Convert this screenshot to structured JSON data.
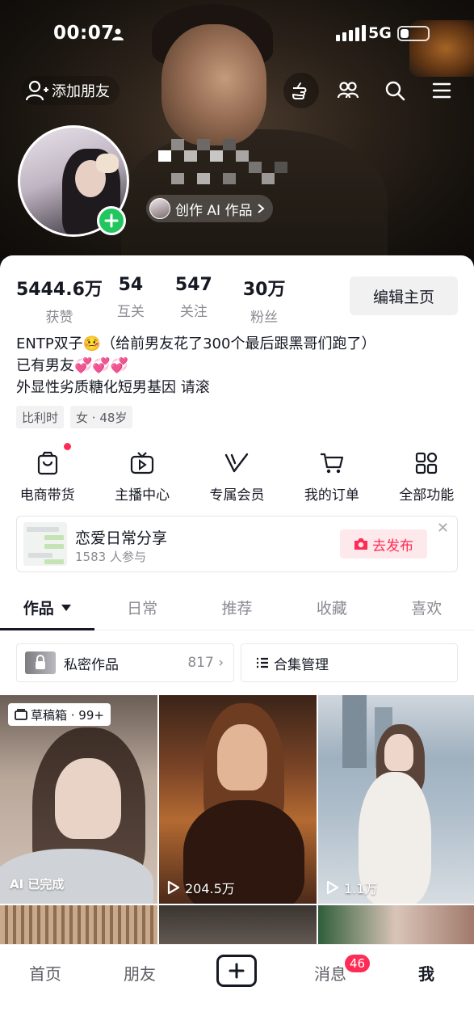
{
  "status_bar": {
    "time": "00:07",
    "network": "5G"
  },
  "top_bar": {
    "add_friend_label": "添加朋友"
  },
  "ai_chip": {
    "label": "创作 AI 作品"
  },
  "stats": [
    {
      "value": "5444.6万",
      "label": "获赞"
    },
    {
      "value": "54",
      "label": "互关"
    },
    {
      "value": "547",
      "label": "关注"
    },
    {
      "value": "30万",
      "label": "粉丝"
    }
  ],
  "edit_profile_label": "编辑主页",
  "bio": {
    "line1": "ENTP双子🤒（给前男友花了300个最后跟黑哥们跑了）",
    "line2": "已有男友💞💞💞",
    "line3": "外显性劣质糖化短男基因 请滚"
  },
  "tags": [
    "比利时",
    "女 · 48岁"
  ],
  "features": [
    {
      "label": "电商带货",
      "icon": "shopping-bag-icon"
    },
    {
      "label": "主播中心",
      "icon": "tv-icon"
    },
    {
      "label": "专属会员",
      "icon": "v-icon"
    },
    {
      "label": "我的订单",
      "icon": "cart-icon"
    },
    {
      "label": "全部功能",
      "icon": "grid-icon"
    }
  ],
  "topic": {
    "title": "恋爱日常分享",
    "participants": "1583 人参与",
    "publish_label": "去发布"
  },
  "tabs": [
    {
      "label": "作品",
      "active": true
    },
    {
      "label": "日常"
    },
    {
      "label": "推荐"
    },
    {
      "label": "收藏"
    },
    {
      "label": "喜欢"
    }
  ],
  "tools": {
    "private_label": "私密作品",
    "private_count": "817",
    "collection_label": "合集管理"
  },
  "grid": [
    {
      "draft_label": "草稿箱 · 99+",
      "ai_label": "AI 已完成"
    },
    {
      "plays": "204.5万"
    },
    {
      "plays": "1.1万"
    }
  ],
  "bottom_nav": {
    "home": "首页",
    "friends": "朋友",
    "messages": "消息",
    "messages_badge": "46",
    "me": "我"
  },
  "colors": {
    "accent": "#fe2c55",
    "green": "#22c55e",
    "text": "#161823",
    "muted": "#8a8b91"
  }
}
